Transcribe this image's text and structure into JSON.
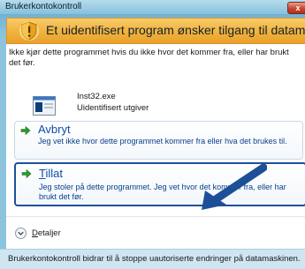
{
  "window": {
    "title": "Brukerkontokontroll",
    "close_label": "x"
  },
  "banner": {
    "text": "Et uidentifisert program ønsker tilgang til datamaskinen",
    "icon": "shield-warning-icon"
  },
  "description": "Ikke kjør dette programmet hvis du ikke hvor det kommer fra, eller har brukt det før.",
  "program": {
    "name": "Inst32.exe",
    "publisher": "Uidentifisert utgiver"
  },
  "options": {
    "cancel": {
      "title": "Avbryt",
      "description": "Jeg vet ikke hvor dette programmet kommer fra eller hva det brukes til."
    },
    "allow": {
      "title_accel": "T",
      "title_rest": "illat",
      "description": "Jeg stoler på dette programmet. Jeg vet hvor det kommer fra, eller har brukt det før."
    }
  },
  "details": {
    "accel": "D",
    "rest": "etaljer"
  },
  "footer": {
    "text": "Brukerkontokontroll bidrar til å stoppe uautoriserte endringer på datamaskinen."
  },
  "colors": {
    "banner": "#f1b440",
    "option_text": "#0b4ea8",
    "highlight_border": "#1f4f9c",
    "pointer_arrow": "#1d4f99",
    "footer_bg": "#cfe6f2"
  }
}
